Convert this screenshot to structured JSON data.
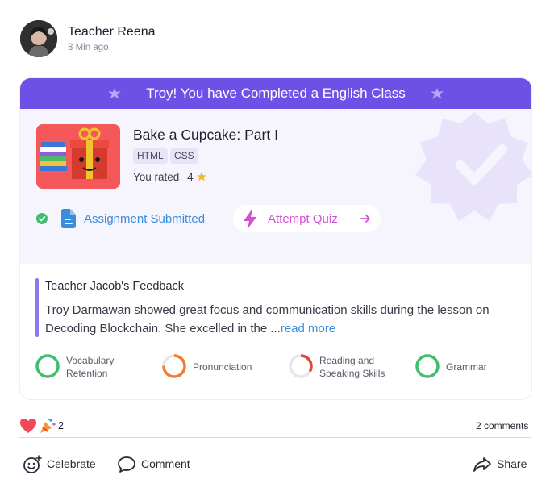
{
  "post": {
    "author": "Teacher Reena",
    "time": "8 Min ago"
  },
  "banner": {
    "text": "Troy! You have Completed a English Class"
  },
  "course": {
    "title": "Bake a Cupcake: Part I",
    "tags": [
      "HTML",
      "CSS"
    ],
    "rated_label": "You rated",
    "rating": "4"
  },
  "status": {
    "assignment": "Assignment Submitted",
    "quiz": "Attempt Quiz"
  },
  "feedback": {
    "title": "Teacher Jacob's Feedback",
    "text": "Troy Darmawan showed great focus and communication skills during the lesson on Decoding Blockchain. She excelled in the ...",
    "read_more": "read more"
  },
  "skills": [
    {
      "line1": "Vocabulary",
      "line2": "Retention",
      "progress": 1.0,
      "color": "#3fbf6b"
    },
    {
      "line1": "Pronunciation",
      "line2": "",
      "progress": 0.75,
      "color": "#f47a2c"
    },
    {
      "line1": "Reading and",
      "line2": "Speaking Skills",
      "progress": 0.33,
      "color": "#e0483e"
    },
    {
      "line1": "Grammar",
      "line2": "",
      "progress": 1.0,
      "color": "#3fbf6b"
    }
  ],
  "social": {
    "reaction_count": "2",
    "comments": "2 comments",
    "actions": {
      "celebrate": "Celebrate",
      "comment": "Comment",
      "share": "Share"
    }
  },
  "icons": [
    "heart-icon",
    "party-popper-icon",
    "sparkle-icon",
    "check-circle-icon",
    "document-icon",
    "lightning-icon",
    "arrow-right-icon",
    "star-icon",
    "celebrate-icon",
    "comment-icon",
    "share-icon"
  ]
}
